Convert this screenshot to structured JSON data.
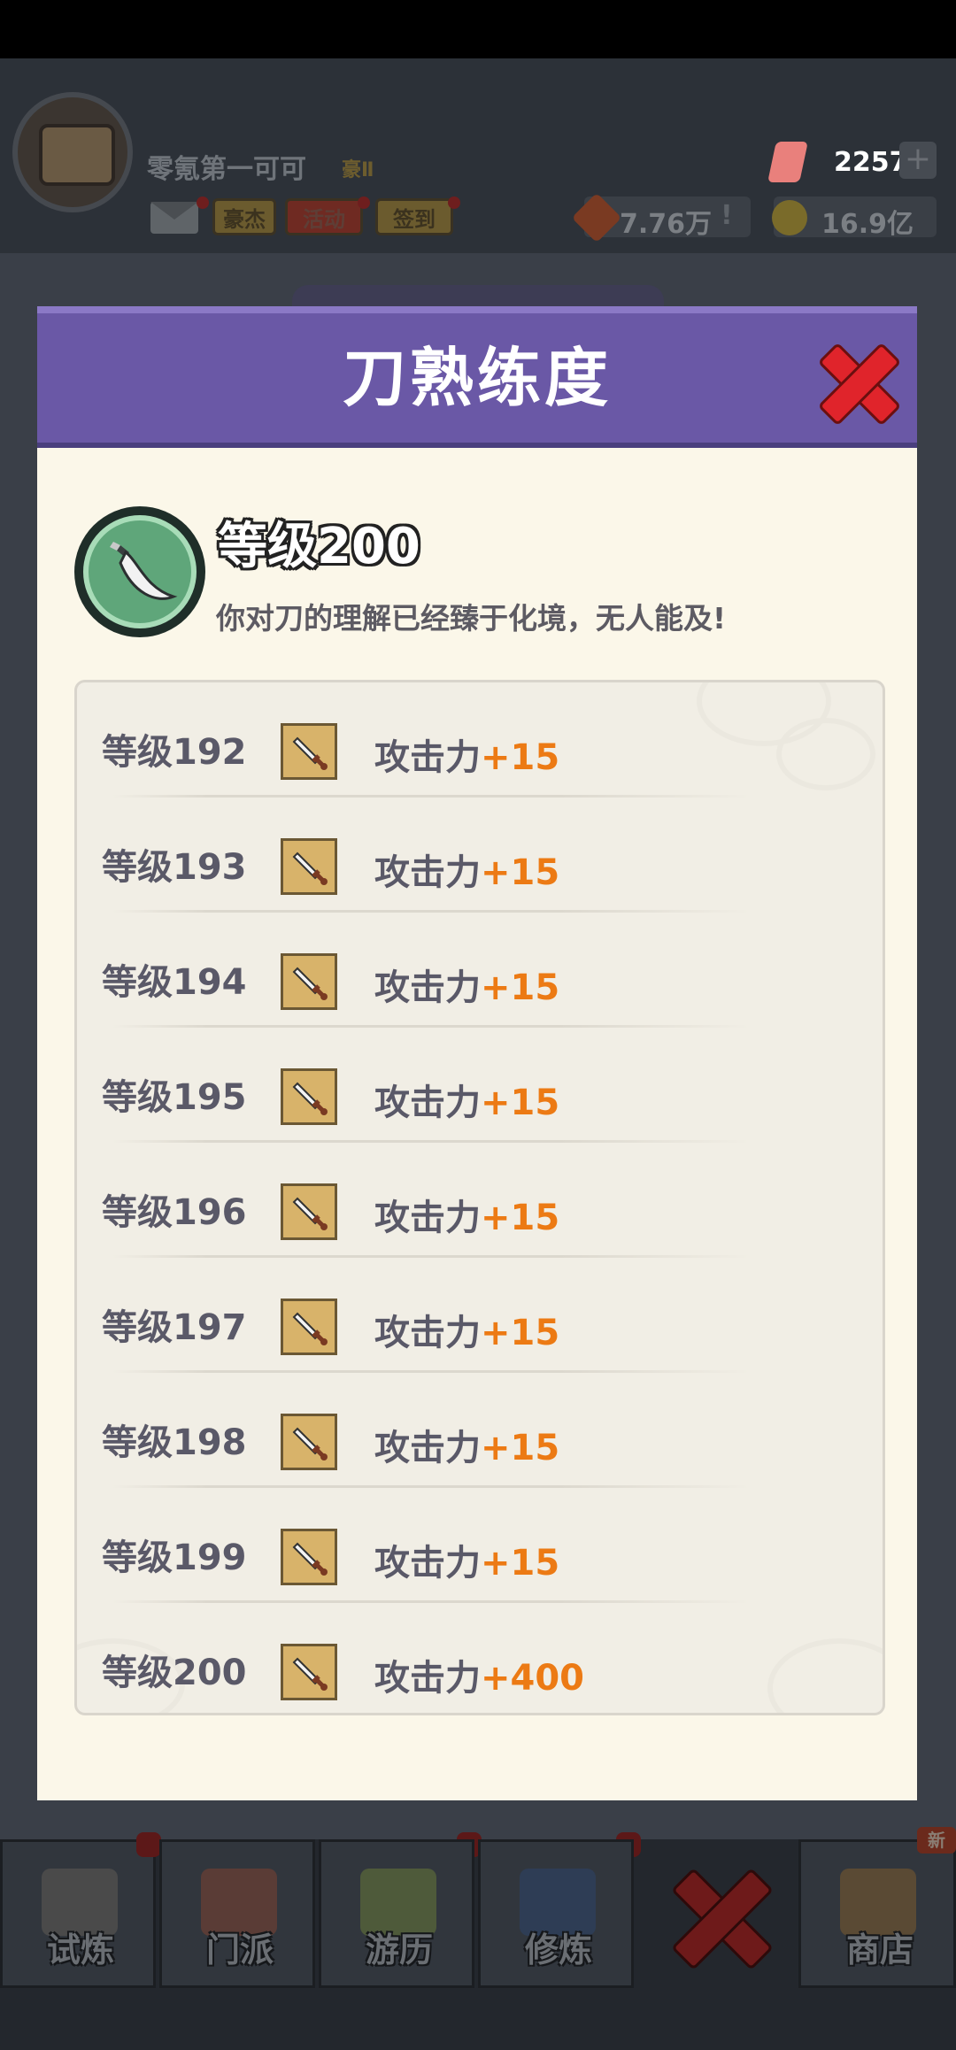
{
  "header": {
    "player_name": "零氪第一可可",
    "player_rank": "豪Ⅱ",
    "buttons": {
      "haojie": "豪杰",
      "activity": "活动",
      "signin": "签到"
    },
    "gems": "2257",
    "power": "7.76万",
    "power_alert": "!",
    "coins": "16.9亿",
    "plus": "+"
  },
  "modal": {
    "title": "刀熟练度",
    "current_level": "等级200",
    "description": "你对刀的理解已经臻于化境，无人能及!",
    "rows": [
      {
        "level": "等级192",
        "stat": "攻击力",
        "bonus": "+15"
      },
      {
        "level": "等级193",
        "stat": "攻击力",
        "bonus": "+15"
      },
      {
        "level": "等级194",
        "stat": "攻击力",
        "bonus": "+15"
      },
      {
        "level": "等级195",
        "stat": "攻击力",
        "bonus": "+15"
      },
      {
        "level": "等级196",
        "stat": "攻击力",
        "bonus": "+15"
      },
      {
        "level": "等级197",
        "stat": "攻击力",
        "bonus": "+15"
      },
      {
        "level": "等级198",
        "stat": "攻击力",
        "bonus": "+15"
      },
      {
        "level": "等级199",
        "stat": "攻击力",
        "bonus": "+15"
      },
      {
        "level": "等级200",
        "stat": "攻击力",
        "bonus": "+400"
      }
    ]
  },
  "nav": {
    "items": [
      "试炼",
      "门派",
      "游历",
      "修炼",
      "商店"
    ],
    "new_badge": "新"
  },
  "colors": {
    "modal_header": "#6a58a6",
    "bonus": "#ec7a14",
    "close": "#e0242b"
  }
}
